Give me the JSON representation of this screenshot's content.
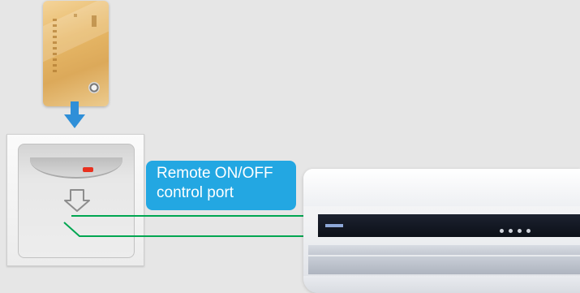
{
  "label": {
    "line1": "Remote ON/OFF",
    "line2": "control port"
  },
  "colors": {
    "background": "#e6e6e6",
    "label_fill": "#23a7e2",
    "wire": "#00a651",
    "arrow": "#2f8fd8",
    "led": "#e8311f"
  },
  "icons": [
    "key-card",
    "down-arrow",
    "card-insert-arrow-icon",
    "led-indicator",
    "air-conditioner"
  ]
}
